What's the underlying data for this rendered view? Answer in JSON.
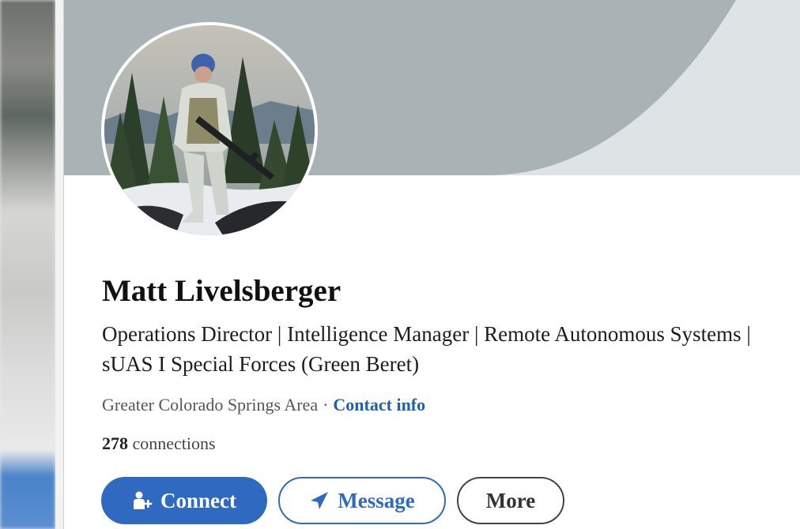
{
  "profile": {
    "name": "Matt Livelsberger",
    "headline": "Operations Director | Intelligence Manager | Remote Autonomous Systems | sUAS I Special Forces (Green Beret)",
    "location": "Greater Colorado Springs Area",
    "separator": "·",
    "contact_link": "Contact info",
    "connections_count": "278",
    "connections_label": "connections"
  },
  "actions": {
    "connect_label": "Connect",
    "message_label": "Message",
    "more_label": "More"
  },
  "icons": {
    "connect": "add-person-icon",
    "message": "send-arrow-icon"
  },
  "colors": {
    "primary": "#2f6ac0",
    "cover": "#a9b3b5",
    "link": "#1f5fae"
  }
}
